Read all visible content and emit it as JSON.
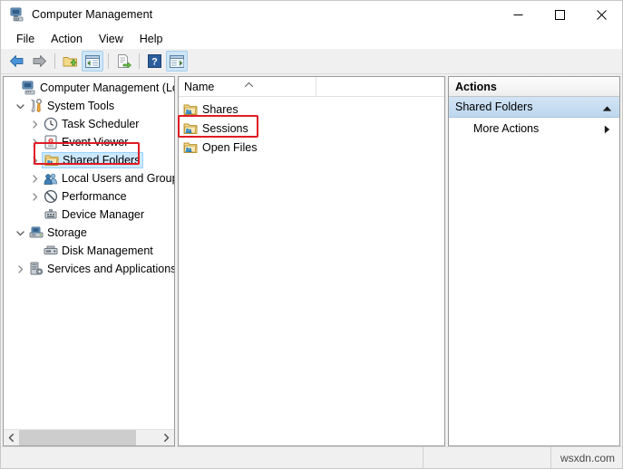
{
  "window": {
    "title": "Computer Management",
    "icon": "computer-management-icon",
    "controls": {
      "minimize": "minimize-icon",
      "maximize": "maximize-icon",
      "close": "close-icon"
    }
  },
  "menubar": {
    "items": [
      {
        "label": "File"
      },
      {
        "label": "Action"
      },
      {
        "label": "View"
      },
      {
        "label": "Help"
      }
    ]
  },
  "toolbar": {
    "buttons": [
      {
        "name": "back-button",
        "icon": "arrow-left-icon",
        "active": false
      },
      {
        "name": "forward-button",
        "icon": "arrow-right-icon",
        "active": false
      },
      {
        "name": "up-one-level-button",
        "icon": "folder-up-icon",
        "active": false
      },
      {
        "name": "show-hide-console-tree-button",
        "icon": "console-tree-icon",
        "active": true
      },
      {
        "name": "export-list-button",
        "icon": "export-list-icon",
        "active": false
      },
      {
        "name": "help-button",
        "icon": "question-mark-icon",
        "active": false
      },
      {
        "name": "show-hide-action-pane-button",
        "icon": "action-pane-icon",
        "active": true
      }
    ]
  },
  "tree": {
    "items": [
      {
        "label": "Computer Management (Local",
        "icon": "computer-icon",
        "indent": 0,
        "twisty": "none",
        "selected": false
      },
      {
        "label": "System Tools",
        "icon": "system-tools-icon",
        "indent": 1,
        "twisty": "expanded",
        "selected": false
      },
      {
        "label": "Task Scheduler",
        "icon": "clock-icon",
        "indent": 2,
        "twisty": "collapsed",
        "selected": false
      },
      {
        "label": "Event Viewer",
        "icon": "event-viewer-icon",
        "indent": 2,
        "twisty": "collapsed",
        "selected": false
      },
      {
        "label": "Shared Folders",
        "icon": "shared-folder-icon",
        "indent": 2,
        "twisty": "collapsed",
        "selected": true
      },
      {
        "label": "Local Users and Groups",
        "icon": "users-groups-icon",
        "indent": 2,
        "twisty": "collapsed",
        "selected": false
      },
      {
        "label": "Performance",
        "icon": "performance-icon",
        "indent": 2,
        "twisty": "collapsed",
        "selected": false
      },
      {
        "label": "Device Manager",
        "icon": "device-manager-icon",
        "indent": 2,
        "twisty": "none",
        "selected": false
      },
      {
        "label": "Storage",
        "icon": "storage-icon",
        "indent": 1,
        "twisty": "expanded",
        "selected": false
      },
      {
        "label": "Disk Management",
        "icon": "disk-management-icon",
        "indent": 2,
        "twisty": "none",
        "selected": false
      },
      {
        "label": "Services and Applications",
        "icon": "services-icon",
        "indent": 1,
        "twisty": "collapsed",
        "selected": false
      }
    ],
    "scrollbar": {
      "left_arrow": "chevron-left-icon",
      "right_arrow": "chevron-right-icon"
    }
  },
  "list": {
    "column_header": "Name",
    "sort_direction": "ascending",
    "rows": [
      {
        "label": "Shares",
        "icon": "shared-folder-icon"
      },
      {
        "label": "Sessions",
        "icon": "shared-folder-icon"
      },
      {
        "label": "Open Files",
        "icon": "shared-folder-icon"
      }
    ]
  },
  "actions": {
    "title": "Actions",
    "section_label": "Shared Folders",
    "collapse_icon": "triangle-up-icon",
    "items": [
      {
        "label": "More Actions",
        "submenu_icon": "triangle-right-icon"
      }
    ]
  },
  "statusbar": {
    "watermark": "wsxdn.com"
  },
  "annotations": [
    {
      "name": "annotation-shared-folders",
      "target": "tree shared-folders",
      "color": "#e01b24"
    },
    {
      "name": "annotation-sessions",
      "target": "list sessions",
      "color": "#e01b24"
    }
  ]
}
